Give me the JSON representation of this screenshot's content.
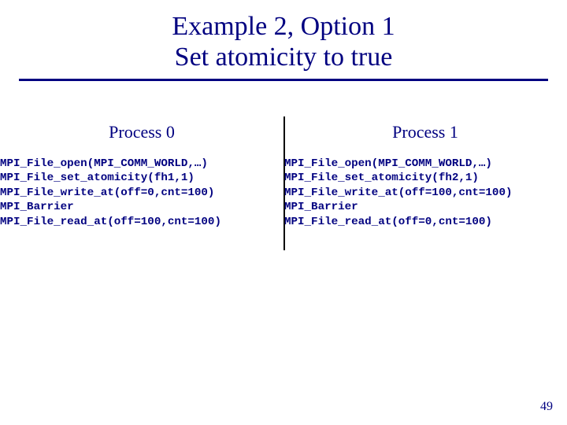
{
  "title_line1": "Example 2, Option 1",
  "title_line2": "Set atomicity to true",
  "process0_heading": "Process 0",
  "process1_heading": "Process 1",
  "code_p0_l1": "MPI_File_open(MPI_COMM_WORLD,…)",
  "code_p0_l2": "MPI_File_set_atomicity(fh1,1)",
  "code_p0_l3": "MPI_File_write_at(off=0,cnt=100)",
  "code_p0_l4": "MPI_Barrier",
  "code_p0_l5": "MPI_File_read_at(off=100,cnt=100)",
  "code_p1_l1": "MPI_File_open(MPI_COMM_WORLD,…)",
  "code_p1_l2": "MPI_File_set_atomicity(fh2,1)",
  "code_p1_l3": "MPI_File_write_at(off=100,cnt=100)",
  "code_p1_l4": "MPI_Barrier",
  "code_p1_l5": "MPI_File_read_at(off=0,cnt=100)",
  "page_number": "49"
}
